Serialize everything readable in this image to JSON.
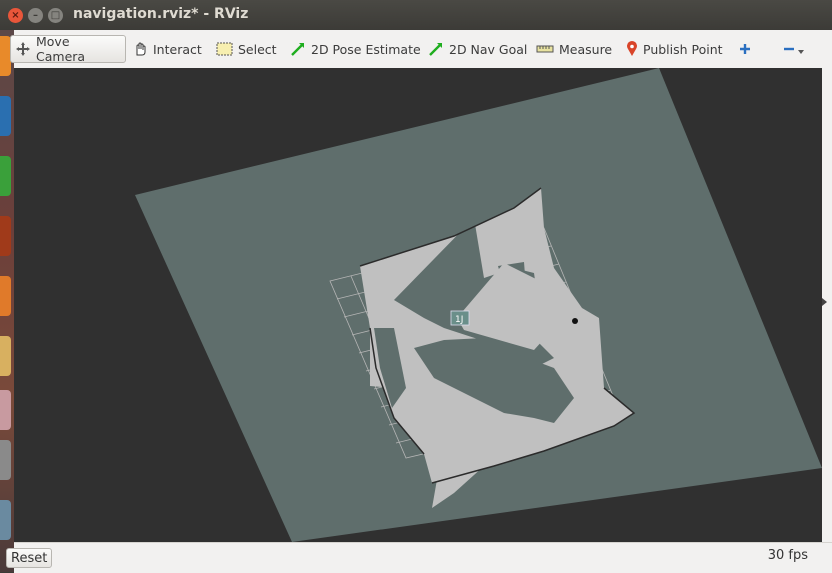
{
  "window": {
    "title": "navigation.rviz* - RViz"
  },
  "toolbar": {
    "tools": [
      {
        "label": "Move Camera",
        "icon": "move-camera-icon"
      },
      {
        "label": "Interact",
        "icon": "hand-icon"
      },
      {
        "label": "Select",
        "icon": "select-box-icon"
      },
      {
        "label": "2D Pose Estimate",
        "icon": "green-arrow-icon"
      },
      {
        "label": "2D Nav Goal",
        "icon": "green-arrow-icon"
      },
      {
        "label": "Measure",
        "icon": "ruler-icon"
      },
      {
        "label": "Publish Point",
        "icon": "map-pin-icon"
      }
    ],
    "add_icon": "plus-icon",
    "remove_icon": "minus-icon"
  },
  "viewport": {
    "marker_label": "1J"
  },
  "status": {
    "reset_label": "Reset",
    "fps": "30 fps"
  },
  "colors": {
    "map_bg": "#5f6e6c",
    "free_space": "#c0c0c0",
    "grid": "#b5b5b5",
    "viewport_bg": "#303030"
  }
}
